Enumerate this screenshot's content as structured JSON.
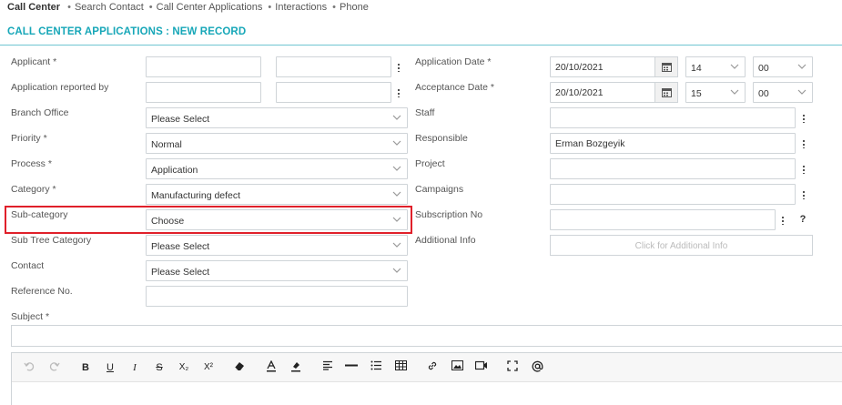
{
  "breadcrumb": {
    "items": [
      "Call Center",
      "Search Contact",
      "Call Center Applications",
      "Interactions",
      "Phone"
    ]
  },
  "page": {
    "title": "CALL CENTER APPLICATIONS : NEW RECORD"
  },
  "left_form": {
    "applicant_label": "Applicant *",
    "reported_by_label": "Application reported by",
    "branch_label": "Branch Office",
    "branch_value": "Please Select",
    "priority_label": "Priority *",
    "priority_value": "Normal",
    "process_label": "Process *",
    "process_value": "Application",
    "category_label": "Category *",
    "category_value": "Manufacturing defect",
    "subcategory_label": "Sub-category",
    "subcategory_value": "Choose",
    "subtree_label": "Sub Tree Category",
    "subtree_value": "Please Select",
    "contact_label": "Contact",
    "contact_value": "Please Select",
    "reference_label": "Reference No.",
    "subject_label": "Subject *"
  },
  "right_form": {
    "app_date_label": "Application Date *",
    "app_date_value": "20/10/2021",
    "app_hour": "14",
    "app_minute": "00",
    "accept_date_label": "Acceptance Date *",
    "accept_date_value": "20/10/2021",
    "accept_hour": "15",
    "accept_minute": "00",
    "staff_label": "Staff",
    "responsible_label": "Responsible",
    "responsible_value": "Erman Bozgeyik",
    "project_label": "Project",
    "campaigns_label": "Campaigns",
    "subscription_label": "Subscription No",
    "help_symbol": "?",
    "additional_label": "Additional Info",
    "additional_button": "Click for Additional Info"
  },
  "toolbar": {
    "bold": "B",
    "underline": "U",
    "italic": "I",
    "strike": "S",
    "subscript": "X₂",
    "superscript": "X²"
  },
  "colors": {
    "accent": "#17a7b8",
    "highlight": "#e0202a",
    "border": "#cfd4d8"
  }
}
